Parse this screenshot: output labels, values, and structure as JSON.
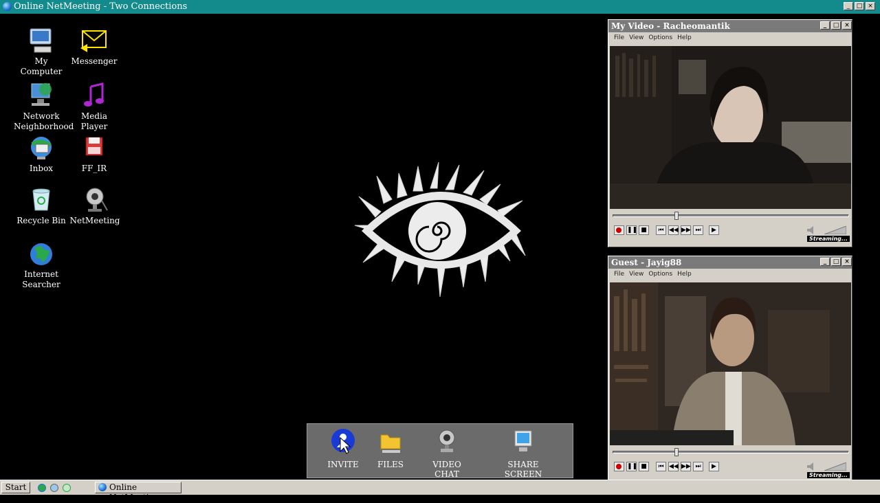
{
  "window": {
    "title": "Online NetMeeting - Two Connections",
    "controls": [
      "_",
      "□",
      "×"
    ]
  },
  "desktop": {
    "icons": [
      {
        "label": "My Computer",
        "icon": "computer-icon"
      },
      {
        "label": "Messenger",
        "icon": "envelope-icon"
      },
      {
        "label": "Network Neighborhood",
        "icon": "network-icon"
      },
      {
        "label": "Media Player",
        "icon": "music-note-icon"
      },
      {
        "label": "Inbox",
        "icon": "inbox-icon"
      },
      {
        "label": "FF_IR",
        "icon": "floppy-disk-icon"
      },
      {
        "label": "Recycle Bin",
        "icon": "recycle-bin-icon"
      },
      {
        "label": "NetMeeting",
        "icon": "webcam-icon"
      },
      {
        "label": "Internet Searcher",
        "icon": "globe-icon"
      }
    ]
  },
  "dock": {
    "items": [
      {
        "label": "INVITE",
        "icon": "invite-icon"
      },
      {
        "label": "FILES",
        "icon": "folder-icon"
      },
      {
        "label": "VIDEO CHAT",
        "icon": "webcam-icon"
      },
      {
        "label": "SHARE SCREEN",
        "icon": "monitor-icon"
      }
    ]
  },
  "video_windows": [
    {
      "title": "My Video - Racheomantik",
      "menu": [
        "File",
        "View",
        "Options",
        "Help"
      ],
      "status": "Streaming...",
      "progress": 0.26
    },
    {
      "title": "Guest - Jayig88",
      "menu": [
        "File",
        "View",
        "Options",
        "Help"
      ],
      "status": "Streaming...",
      "progress": 0.26
    }
  ],
  "taskbar": {
    "start_label": "Start",
    "task_label": "Online NetMeeting"
  },
  "colors": {
    "titlebar": "#138a8c",
    "desktop": "#000000",
    "window_chrome": "#d4d0c8",
    "record": "#cc0000"
  }
}
